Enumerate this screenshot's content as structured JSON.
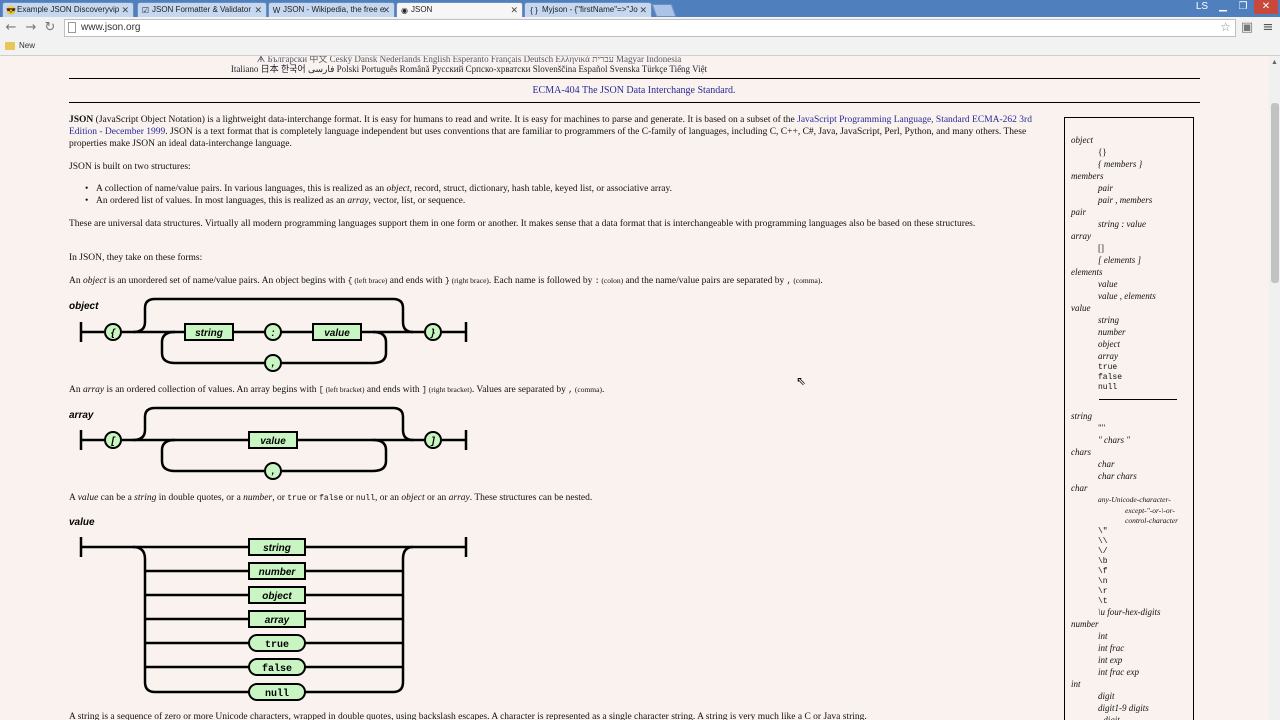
{
  "browser": {
    "tabs": [
      {
        "label": "Example JSON Discoveryvip",
        "icon": "😎"
      },
      {
        "label": "JSON Formatter & Validator",
        "icon": "☑"
      },
      {
        "label": "JSON - Wikipedia, the free e",
        "icon": "W"
      },
      {
        "label": "JSON",
        "icon": "◉"
      },
      {
        "label": "Myjson - {\"firstName\"=>\"Jo",
        "icon": "{ }"
      }
    ],
    "profile": "LS",
    "url": "www.json.org",
    "bookmark": "New"
  },
  "page": {
    "lang_line1": "ᗗ Български 中文 Český Dansk Nederlands English Esperanto Français Deutsch Ελληνικά עברית Magyar Indonesia",
    "lang_line2": "Italiano 日本 한국어 فارسی Polski Português Română Русский Српско-хрватски Slovenščina Español Svenska Türkçe Tiếng Việt",
    "ecma_link": "ECMA-404 The JSON Data Interchange Standard.",
    "intro_bold": "JSON",
    "intro_1": " (JavaScript Object Notation) is a lightweight data-interchange format. It is easy for humans to read and write. It is easy for machines to parse and generate. It is based on a subset of the ",
    "intro_link": "JavaScript Programming Language, Standard ECMA-262 3rd Edition - December 1999",
    "intro_2": ". JSON is a text format that is completely language independent but uses conventions that are familiar to programmers of the C-family of languages, including C, C++, C#, Java, JavaScript, Perl, Python, and many others. These properties make JSON an ideal data-interchange language.",
    "built": "JSON is built on two structures:",
    "bullet1_a": "A collection of name/value pairs. In various languages, this is realized as an ",
    "bullet1_em": "object",
    "bullet1_b": ", record, struct, dictionary, hash table, keyed list, or associative array.",
    "bullet2_a": "An ordered list of values. In most languages, this is realized as an ",
    "bullet2_em": "array",
    "bullet2_b": ", vector, list, or sequence.",
    "universal": "These are universal data structures. Virtually all modern programming languages support them in one form or another. It makes sense that a data format that is interchangeable with programming languages also be based on these structures.",
    "forms": "In JSON, they take on these forms:",
    "object_desc": {
      "a": "An ",
      "em": "object",
      "b": " is an unordered set of name/value pairs. An object begins with ",
      "c1": "{",
      "c1n": " (left brace)",
      "c": " and ends with ",
      "c2": "}",
      "c2n": " (right brace)",
      "d": ". Each name is followed by ",
      "c3": ":",
      "c3n": " (colon)",
      "e": " and the name/value pairs are separated by ",
      "c4": ",",
      "c4n": " (comma)",
      "f": "."
    },
    "array_desc": {
      "a": "An ",
      "em": "array",
      "b": " is an ordered collection of values. An array begins with ",
      "c1": "[",
      "c1n": " (left bracket)",
      "c": " and ends with ",
      "c2": "]",
      "c2n": " (right bracket)",
      "d": ". Values are separated by ",
      "c3": ",",
      "c3n": " (comma)",
      "e": "."
    },
    "value_desc": {
      "a": "A ",
      "em": "value",
      "b": " can be a ",
      "em2": "string",
      "c": " in double quotes, or a ",
      "em3": "number",
      "d": ", or ",
      "t": "true",
      "e": " or ",
      "f": "false",
      "g": " or ",
      "n": "null",
      "h": ", or an ",
      "em4": "object",
      "i": " or an ",
      "em5": "array",
      "j": ". These structures can be nested."
    },
    "string_desc": "A string is a sequence of zero or more Unicode characters, wrapped in double quotes, using backslash escapes. A character is represented as a single character string. A string is very much like a C or Java string.",
    "diagrams": {
      "object": {
        "title": "object",
        "lbrace": "{",
        "rbrace": "}",
        "string": "string",
        "colon": ":",
        "value": "value",
        "comma": ","
      },
      "array": {
        "title": "array",
        "lbracket": "[",
        "rbracket": "]",
        "value": "value",
        "comma": ","
      },
      "value": {
        "title": "value",
        "items": [
          "string",
          "number",
          "object",
          "array",
          "true",
          "false",
          "null"
        ]
      }
    }
  },
  "grammar": {
    "rows": [
      {
        "t": "object",
        "k": "nt",
        "ind": 0
      },
      {
        "t": "{}",
        "k": "lit",
        "ind": 1
      },
      {
        "t": "{ members }",
        "k": "nt",
        "ind": 1
      },
      {
        "t": "members",
        "k": "nt",
        "ind": 0
      },
      {
        "t": "pair",
        "k": "nt",
        "ind": 1
      },
      {
        "t": "pair , members",
        "k": "nt",
        "ind": 1
      },
      {
        "t": "pair",
        "k": "nt",
        "ind": 0
      },
      {
        "t": "string : value",
        "k": "nt",
        "ind": 1
      },
      {
        "t": "array",
        "k": "nt",
        "ind": 0
      },
      {
        "t": "[]",
        "k": "lit",
        "ind": 1
      },
      {
        "t": "[ elements ]",
        "k": "nt",
        "ind": 1
      },
      {
        "t": "elements",
        "k": "nt",
        "ind": 0
      },
      {
        "t": "value",
        "k": "nt",
        "ind": 1
      },
      {
        "t": "value , elements",
        "k": "nt",
        "ind": 1
      },
      {
        "t": "value",
        "k": "nt",
        "ind": 0
      },
      {
        "t": "string",
        "k": "nt",
        "ind": 1
      },
      {
        "t": "number",
        "k": "nt",
        "ind": 1
      },
      {
        "t": "object",
        "k": "nt",
        "ind": 1
      },
      {
        "t": "array",
        "k": "nt",
        "ind": 1
      },
      {
        "t": "true",
        "k": "mono",
        "ind": 1
      },
      {
        "t": "false",
        "k": "mono",
        "ind": 1
      },
      {
        "t": "null",
        "k": "mono",
        "ind": 1
      }
    ],
    "rows2": [
      {
        "t": "string",
        "k": "nt",
        "ind": 0
      },
      {
        "t": "\"\"",
        "k": "lit",
        "ind": 1
      },
      {
        "t": "\" chars \"",
        "k": "nt",
        "ind": 1
      },
      {
        "t": "chars",
        "k": "nt",
        "ind": 0
      },
      {
        "t": "char",
        "k": "nt",
        "ind": 1
      },
      {
        "t": "char chars",
        "k": "nt",
        "ind": 1
      },
      {
        "t": "char",
        "k": "nt",
        "ind": 0
      },
      {
        "t": "any-Unicode-character-",
        "k": "small",
        "ind": 1
      },
      {
        "t": "except-\"-or-\\-or-",
        "k": "small",
        "ind": 2
      },
      {
        "t": "control-character",
        "k": "small",
        "ind": 2
      },
      {
        "t": "\\\"",
        "k": "mono",
        "ind": 1
      },
      {
        "t": "\\\\",
        "k": "mono",
        "ind": 1
      },
      {
        "t": "\\/",
        "k": "mono",
        "ind": 1
      },
      {
        "t": "\\b",
        "k": "mono",
        "ind": 1
      },
      {
        "t": "\\f",
        "k": "mono",
        "ind": 1
      },
      {
        "t": "\\n",
        "k": "mono",
        "ind": 1
      },
      {
        "t": "\\r",
        "k": "mono",
        "ind": 1
      },
      {
        "t": "\\t",
        "k": "mono",
        "ind": 1
      },
      {
        "t": "\\u four-hex-digits",
        "k": "nt",
        "ind": 1
      },
      {
        "t": "number",
        "k": "nt",
        "ind": 0
      },
      {
        "t": "int",
        "k": "nt",
        "ind": 1
      },
      {
        "t": "int frac",
        "k": "nt",
        "ind": 1
      },
      {
        "t": "int exp",
        "k": "nt",
        "ind": 1
      },
      {
        "t": "int frac exp",
        "k": "nt",
        "ind": 1
      },
      {
        "t": "int",
        "k": "nt",
        "ind": 0
      },
      {
        "t": "digit",
        "k": "nt",
        "ind": 1
      },
      {
        "t": "digit1-9 digits",
        "k": "nt",
        "ind": 1
      },
      {
        "t": "- digit",
        "k": "nt",
        "ind": 1
      }
    ]
  },
  "colors": {
    "accent": "#2a2a9a",
    "box_fill": "#c9f5c3",
    "page_bg": "#f9f2ee",
    "tabbar": "#4f7fbd"
  }
}
